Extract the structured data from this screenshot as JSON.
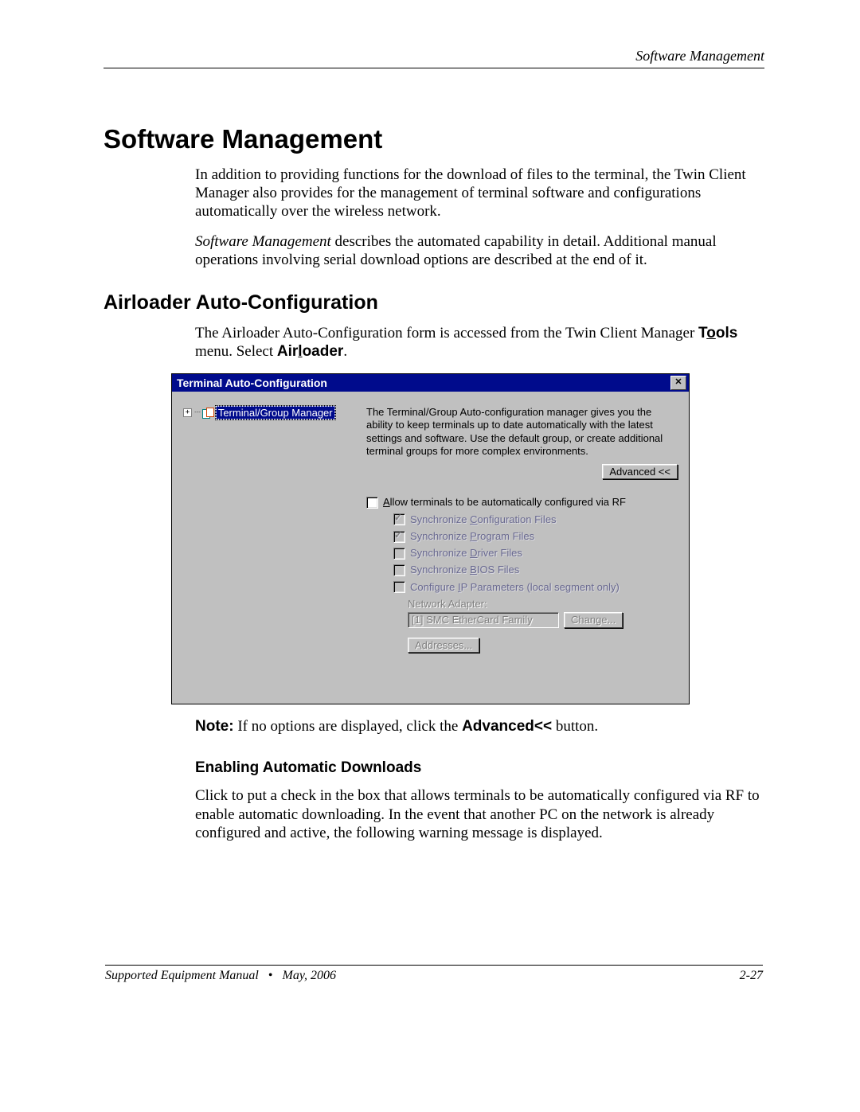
{
  "header": {
    "right": "Software Management"
  },
  "h1": "Software Management",
  "para1": "In addition to providing functions for the download of files to the terminal, the Twin Client Manager also provides for the management of terminal software and configurations automatically over the wireless network.",
  "para2_prefix": "Software Management",
  "para2_rest": " describes the automated capability in detail. Additional manual operations involving serial download options are described at the end of it.",
  "h2": "Airloader Auto-Configuration",
  "para3_a": "The Airloader Auto-Configuration form is accessed from the Twin Client Manager ",
  "para3_b_bold_pre": "T",
  "para3_b_bold_ul": "o",
  "para3_b_bold_post": "ols",
  "para3_c": " menu. Select ",
  "para3_d_bold_pre": "Air",
  "para3_d_bold_ul": "l",
  "para3_d_bold_post": "oader",
  "para3_e": ".",
  "dialog": {
    "title": "Terminal Auto-Configuration",
    "close": "✕",
    "tree_label": "Terminal/Group Manager",
    "desc": "The Terminal/Group Auto-configuration manager gives you the ability to keep terminals up to date automatically with the latest settings and software.  Use the default group, or create additional terminal groups for more complex environments.",
    "advanced": "Advanced <<",
    "allow_pre": "A",
    "allow_rest": "llow terminals to be automatically configured via RF",
    "sync_cfg_pre": "Synchronize ",
    "sync_cfg_ul": "C",
    "sync_cfg_post": "onfiguration Files",
    "sync_prg_pre": "Synchronize ",
    "sync_prg_ul": "P",
    "sync_prg_post": "rogram Files",
    "sync_drv_pre": "Synchronize ",
    "sync_drv_ul": "D",
    "sync_drv_post": "river Files",
    "sync_bios_pre": "Synchronize ",
    "sync_bios_ul": "B",
    "sync_bios_post": "IOS Files",
    "cfg_ip_pre": "Configure ",
    "cfg_ip_ul": "I",
    "cfg_ip_post": "P Parameters (local segment only)",
    "na_label": "Network Adapter:",
    "na_value": "[1] SMC EtherCard Family",
    "change": "Change...",
    "addresses": "Addresses..."
  },
  "note_bold": "Note:",
  "note_rest": " If no options are displayed, click the ",
  "note_adv": "Advanced<<",
  "note_end": " button.",
  "h3": "Enabling Automatic Downloads",
  "para4": "Click to put a check in the box that allows terminals to be automatically configured via RF to enable automatic downloading. In the event that another PC on the network is already configured and active, the following warning message is displayed.",
  "footer": {
    "left_a": "Supported Equipment Manual",
    "left_b": "•",
    "left_c": "May, 2006",
    "right": "2-27"
  }
}
